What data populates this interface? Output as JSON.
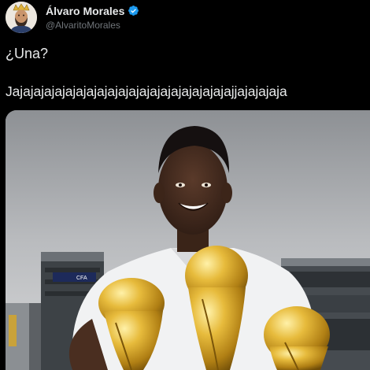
{
  "author": {
    "display_name": "Álvaro Morales",
    "handle": "@AlvaritoMorales",
    "verified_color": "#1d9bf0"
  },
  "tweet": {
    "line1": "¿Una?",
    "line2": "Jajajajajajajajajajajajajajajajajajajajajajjajajajaja"
  },
  "media": {
    "icon": "photo-of-man-holding-three-world-cup-trophies",
    "banner_text": "CFA"
  },
  "colors": {
    "background": "#000000",
    "text": "#e7e9ea",
    "muted": "#71767b",
    "gold": "#d4a52a"
  }
}
